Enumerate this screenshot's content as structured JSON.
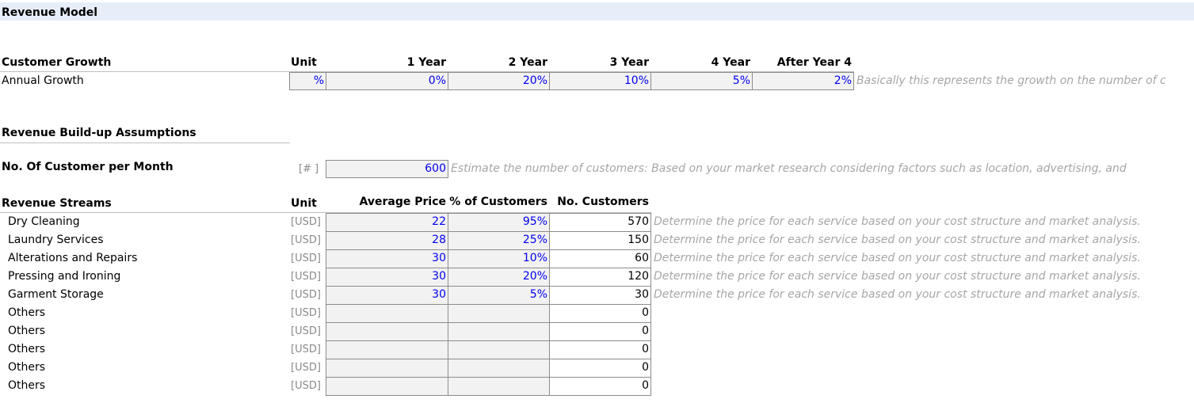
{
  "title": "Revenue Model",
  "customer_growth": {
    "heading": "Customer Growth",
    "headers": [
      "Unit",
      "1 Year",
      "2 Year",
      "3 Year",
      "4 Year",
      "After Year 4"
    ],
    "row_label": "Annual Growth",
    "unit": "%",
    "values": [
      "0%",
      "20%",
      "10%",
      "5%",
      "2%"
    ],
    "note": "Basically this represents the growth on the number of c"
  },
  "assumptions": {
    "heading": "Revenue Build-up Assumptions",
    "customers_label": "No. Of Customer per Month",
    "customers_unit": "[# ]",
    "customers_value": "600",
    "customers_note": "Estimate the number of customers: Based on your market research considering factors such as location, advertising, and"
  },
  "streams": {
    "heading": "Revenue Streams",
    "headers": [
      "Unit",
      "Average Price",
      "% of Customers",
      "No. Customers"
    ],
    "rows": [
      {
        "name": "Dry Cleaning",
        "unit": "[USD]",
        "price": "22",
        "pct": "95%",
        "customers": "570",
        "note": "Determine the price for each service based on your cost structure and market analysis."
      },
      {
        "name": "Laundry Services",
        "unit": "[USD]",
        "price": "28",
        "pct": "25%",
        "customers": "150",
        "note": "Determine the price for each service based on your cost structure and market analysis."
      },
      {
        "name": "Alterations and Repairs",
        "unit": "[USD]",
        "price": "30",
        "pct": "10%",
        "customers": "60",
        "note": "Determine the price for each service based on your cost structure and market analysis."
      },
      {
        "name": "Pressing and Ironing",
        "unit": "[USD]",
        "price": "30",
        "pct": "20%",
        "customers": "120",
        "note": "Determine the price for each service based on your cost structure and market analysis."
      },
      {
        "name": "Garment Storage",
        "unit": "[USD]",
        "price": "30",
        "pct": "5%",
        "customers": "30",
        "note": "Determine the price for each service based on your cost structure and market analysis."
      },
      {
        "name": "Others",
        "unit": "[USD]",
        "price": "",
        "pct": "",
        "customers": "0",
        "note": ""
      },
      {
        "name": "Others",
        "unit": "[USD]",
        "price": "",
        "pct": "",
        "customers": "0",
        "note": ""
      },
      {
        "name": "Others",
        "unit": "[USD]",
        "price": "",
        "pct": "",
        "customers": "0",
        "note": ""
      },
      {
        "name": "Others",
        "unit": "[USD]",
        "price": "",
        "pct": "",
        "customers": "0",
        "note": ""
      },
      {
        "name": "Others",
        "unit": "[USD]",
        "price": "",
        "pct": "",
        "customers": "0",
        "note": ""
      }
    ]
  },
  "colors": {
    "input_text": "#0000ee",
    "title_band": "#e7eef9",
    "note_text": "#a6a6a6"
  }
}
